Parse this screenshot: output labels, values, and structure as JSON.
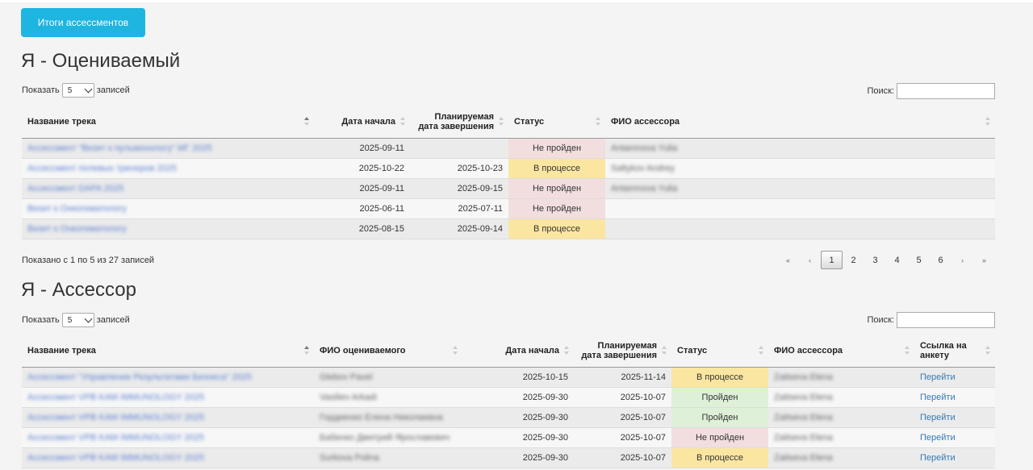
{
  "header": {
    "results_button": "Итоги ассессментов"
  },
  "section1": {
    "title": "Я - Оцениваемый",
    "length": {
      "label_before": "Показать",
      "value": "5",
      "label_after": "записей"
    },
    "search": {
      "label": "Поиск:",
      "value": ""
    },
    "columns": {
      "track": "Название трека",
      "start": "Дата начала",
      "planned_1": "Планируемая",
      "planned_2": "дата завершения",
      "status": "Статус",
      "assessor": "ФИО ассессора"
    },
    "rows": [
      {
        "track": "Ассессмент \"Визит к пульмонологу\" МГ 2025",
        "start": "2025-09-11",
        "end": "",
        "status": "Не пройден",
        "assessor": "Antamnova Yulia"
      },
      {
        "track": "Ассессмент полевых тренеров 2025",
        "start": "2025-10-22",
        "end": "2025-10-23",
        "status": "В процессе",
        "assessor": "Saltykov Andrey"
      },
      {
        "track": "Ассессмент DAPA 2025",
        "start": "2025-09-11",
        "end": "2025-09-15",
        "status": "Не пройден",
        "assessor": "Antamnova Yulia"
      },
      {
        "track": "Визит к Онкогематологу",
        "start": "2025-06-11",
        "end": "2025-07-11",
        "status": "Не пройден",
        "assessor": ""
      },
      {
        "track": "Визит к Онкогематологу",
        "start": "2025-08-15",
        "end": "2025-09-14",
        "status": "В процессе",
        "assessor": ""
      }
    ],
    "info": "Показано с 1 по 5 из 27 записей",
    "pagination": {
      "first": "«",
      "prev": "‹",
      "pages": [
        "1",
        "2",
        "3",
        "4",
        "5",
        "6"
      ],
      "current": "1",
      "next": "›",
      "last": "»"
    }
  },
  "section2": {
    "title": "Я - Ассессор",
    "length": {
      "label_before": "Показать",
      "value": "5",
      "label_after": "записей"
    },
    "search": {
      "label": "Поиск:",
      "value": ""
    },
    "columns": {
      "track": "Название трека",
      "assessee": "ФИО оцениваемого",
      "start": "Дата начала",
      "planned_1": "Планируемая",
      "planned_2": "дата завершения",
      "status": "Статус",
      "assessor": "ФИО ассессора",
      "link": "Ссылка на анкету"
    },
    "rows": [
      {
        "track": "Ассессмент \"Управление Результатами Бизнеса\" 2025",
        "assessee": "Glebov Pavel",
        "start": "2025-10-15",
        "end": "2025-11-14",
        "status": "В процессе",
        "assessor": "Zaitseva Elena",
        "link": "Перейти"
      },
      {
        "track": "Ассессмент VPB KAM IMMUNOLOGY 2025",
        "assessee": "Vasiliev Arkadi",
        "start": "2025-09-30",
        "end": "2025-10-07",
        "status": "Пройден",
        "assessor": "Zaitseva Elena",
        "link": "Перейти"
      },
      {
        "track": "Ассессмент VPB KAM IMMUNOLOGY 2025",
        "assessee": "Гордиенко Елена Николаевна",
        "start": "2025-09-30",
        "end": "2025-10-07",
        "status": "Пройден",
        "assessor": "Zaitseva Elena",
        "link": "Перейти"
      },
      {
        "track": "Ассессмент VPB KAM IMMUNOLOGY 2025",
        "assessee": "Бабенко Дмитрий Ярославович",
        "start": "2025-09-30",
        "end": "2025-10-07",
        "status": "Не пройден",
        "assessor": "Zaitseva Elena",
        "link": "Перейти"
      },
      {
        "track": "Ассессмент VPB KAM IMMUNOLOGY 2025",
        "assessee": "Surkova Polina",
        "start": "2025-09-30",
        "end": "2025-10-07",
        "status": "В процессе",
        "assessor": "Zaitseva Elena",
        "link": "Перейти"
      }
    ]
  }
}
